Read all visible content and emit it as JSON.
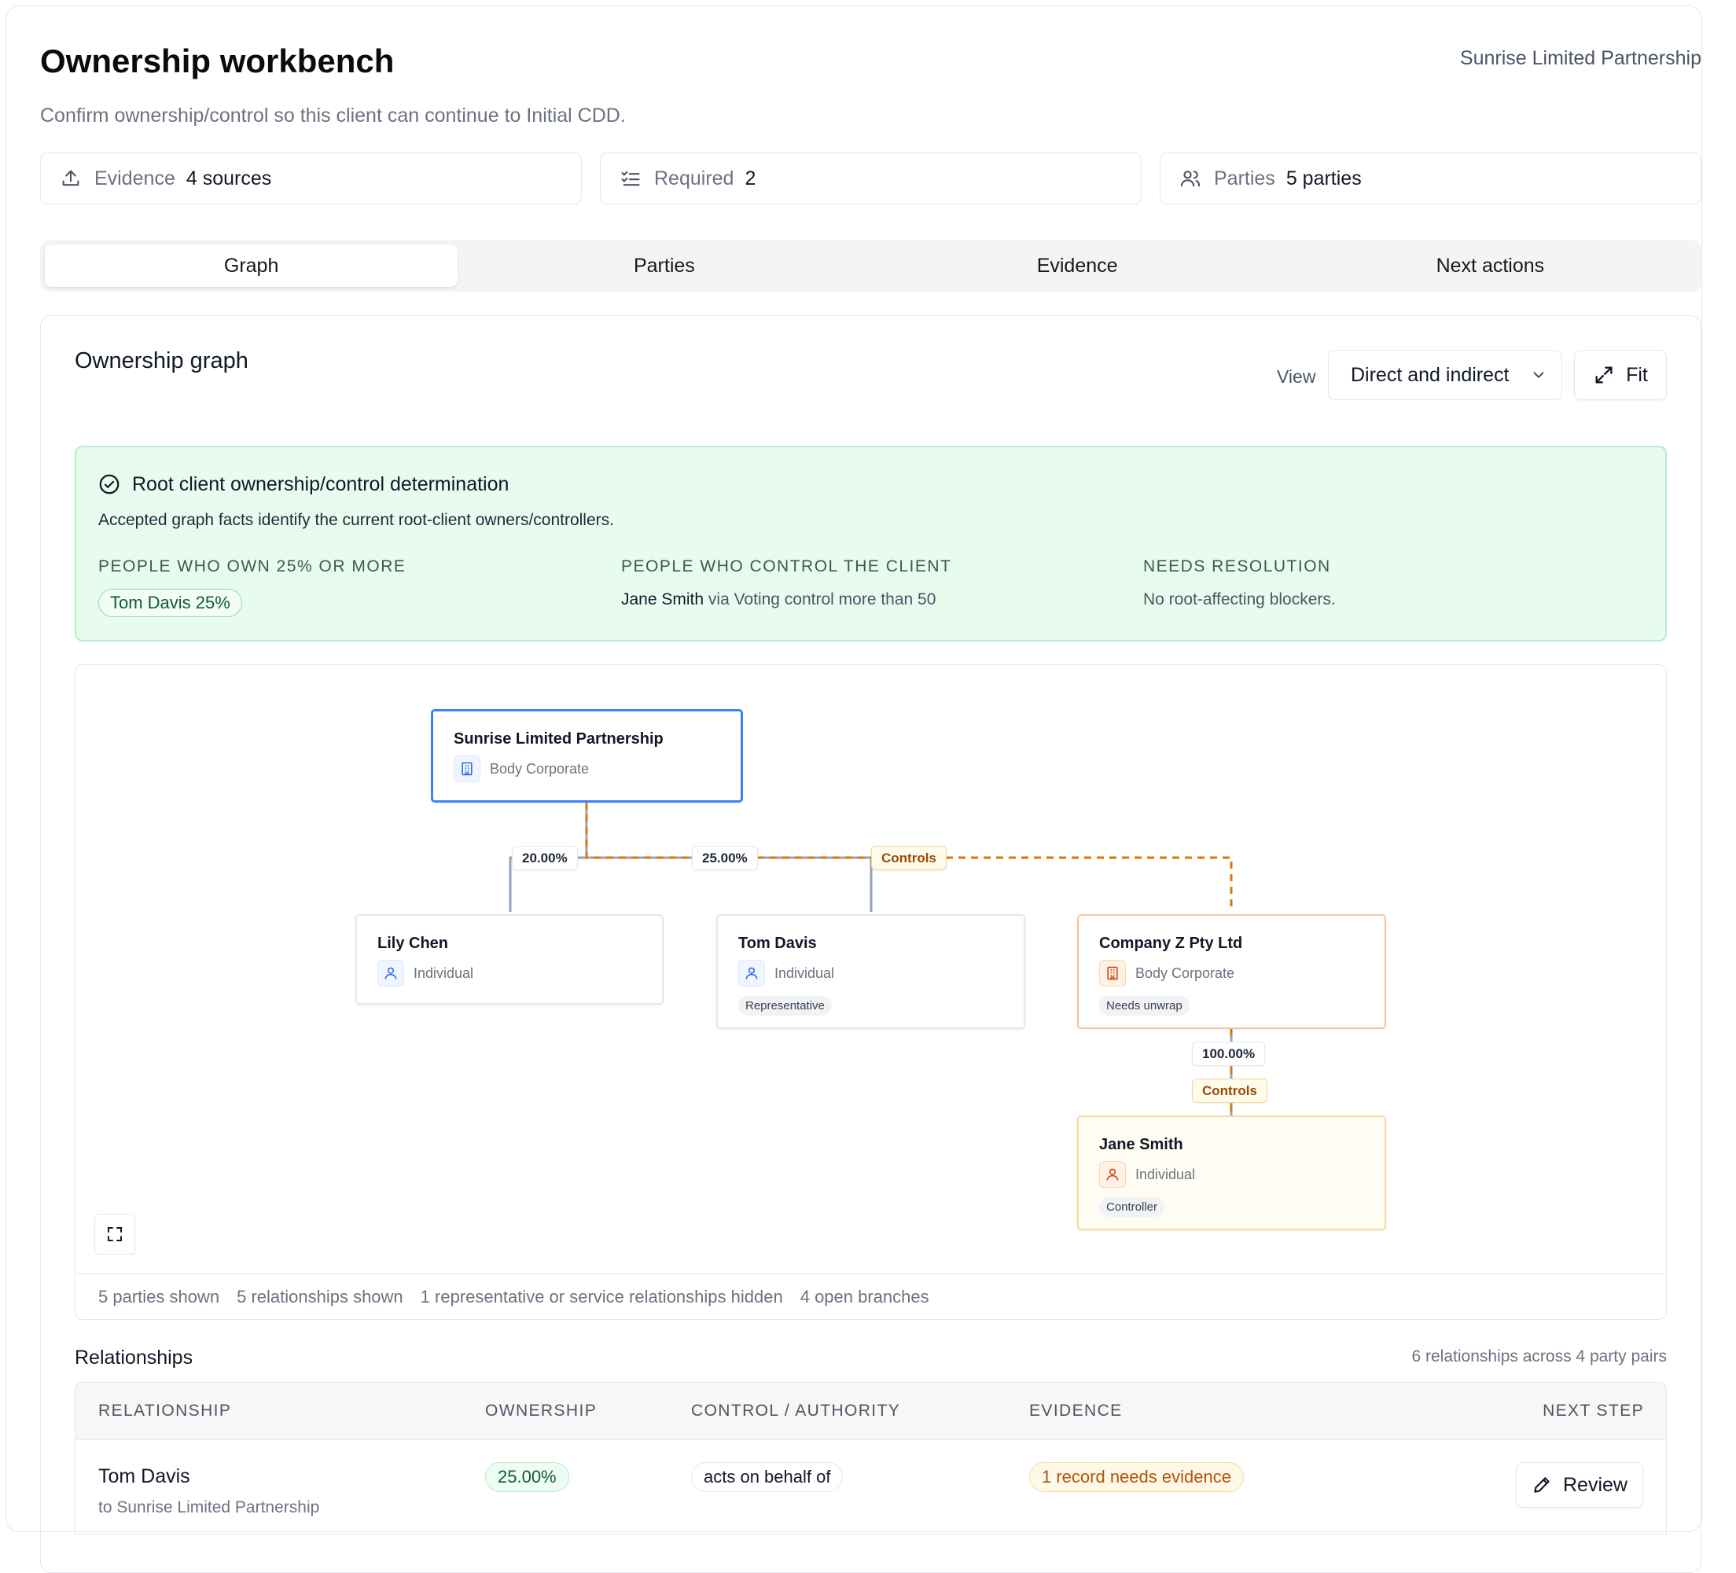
{
  "header": {
    "title": "Ownership workbench",
    "client_name": "Sunrise Limited Partnership",
    "subtitle": "Confirm ownership/control so this client can continue to Initial CDD."
  },
  "stats": [
    {
      "label": "Evidence",
      "value": "4 sources",
      "icon": "upload-icon"
    },
    {
      "label": "Required",
      "value": "2",
      "icon": "checklist-icon"
    },
    {
      "label": "Parties",
      "value": "5 parties",
      "icon": "users-icon"
    }
  ],
  "tabs": [
    {
      "label": "Graph",
      "active": true
    },
    {
      "label": "Parties",
      "active": false
    },
    {
      "label": "Evidence",
      "active": false
    },
    {
      "label": "Next actions",
      "active": false
    }
  ],
  "graph_card": {
    "title": "Ownership graph",
    "view_label": "View",
    "view_value": "Direct and indirect",
    "fit_label": "Fit"
  },
  "determination": {
    "title": "Root client ownership/control determination",
    "description": "Accepted graph facts identify the current root-client owners/controllers.",
    "owners_heading": "PEOPLE WHO OWN 25% OR MORE",
    "owners_value": "Tom Davis 25%",
    "controllers_heading": "PEOPLE WHO CONTROL THE CLIENT",
    "controllers_name": "Jane Smith",
    "controllers_via": "via Voting control more than 50",
    "resolution_heading": "NEEDS RESOLUTION",
    "resolution_value": "No root-affecting blockers."
  },
  "nodes": {
    "root": {
      "name": "Sunrise Limited Partnership",
      "type": "Body Corporate"
    },
    "lily": {
      "name": "Lily Chen",
      "type": "Individual"
    },
    "tom": {
      "name": "Tom Davis",
      "type": "Individual",
      "tag": "Representative"
    },
    "companyz": {
      "name": "Company Z Pty Ltd",
      "type": "Body Corporate",
      "tag": "Needs unwrap"
    },
    "jane": {
      "name": "Jane Smith",
      "type": "Individual",
      "tag": "Controller"
    }
  },
  "edges": {
    "lily_pct": "20.00%",
    "tom_pct": "25.00%",
    "root_controls": "Controls",
    "z_pct": "100.00%",
    "z_controls": "Controls"
  },
  "graph_stats": [
    "5 parties shown",
    "5 relationships shown",
    "1 representative or service relationships hidden",
    "4 open branches"
  ],
  "relationships": {
    "title": "Relationships",
    "count": "6 relationships across 4 party pairs",
    "columns": [
      "RELATIONSHIP",
      "OWNERSHIP",
      "CONTROL / AUTHORITY",
      "EVIDENCE",
      "NEXT STEP"
    ],
    "rows": [
      {
        "name": "Tom Davis",
        "sub": "to Sunrise Limited Partnership",
        "ownership": "25.00%",
        "control": "acts on behalf of",
        "evidence": "1 record needs evidence",
        "action": "Review"
      }
    ]
  },
  "colors": {
    "accent_blue": "#3b82f6",
    "control_orange": "#d97706",
    "success_green": "#e8fbef"
  }
}
